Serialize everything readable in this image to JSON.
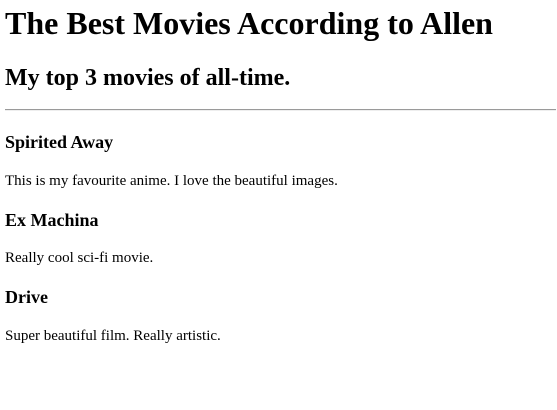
{
  "page": {
    "title": "The Best Movies According to Allen",
    "subtitle": "My top 3 movies of all-time."
  },
  "movies": [
    {
      "title": "Spirited Away",
      "description": "This is my favourite anime. I love the beautiful images."
    },
    {
      "title": "Ex Machina",
      "description": "Really cool sci-fi movie."
    },
    {
      "title": "Drive",
      "description": "Super beautiful film. Really artistic."
    }
  ]
}
